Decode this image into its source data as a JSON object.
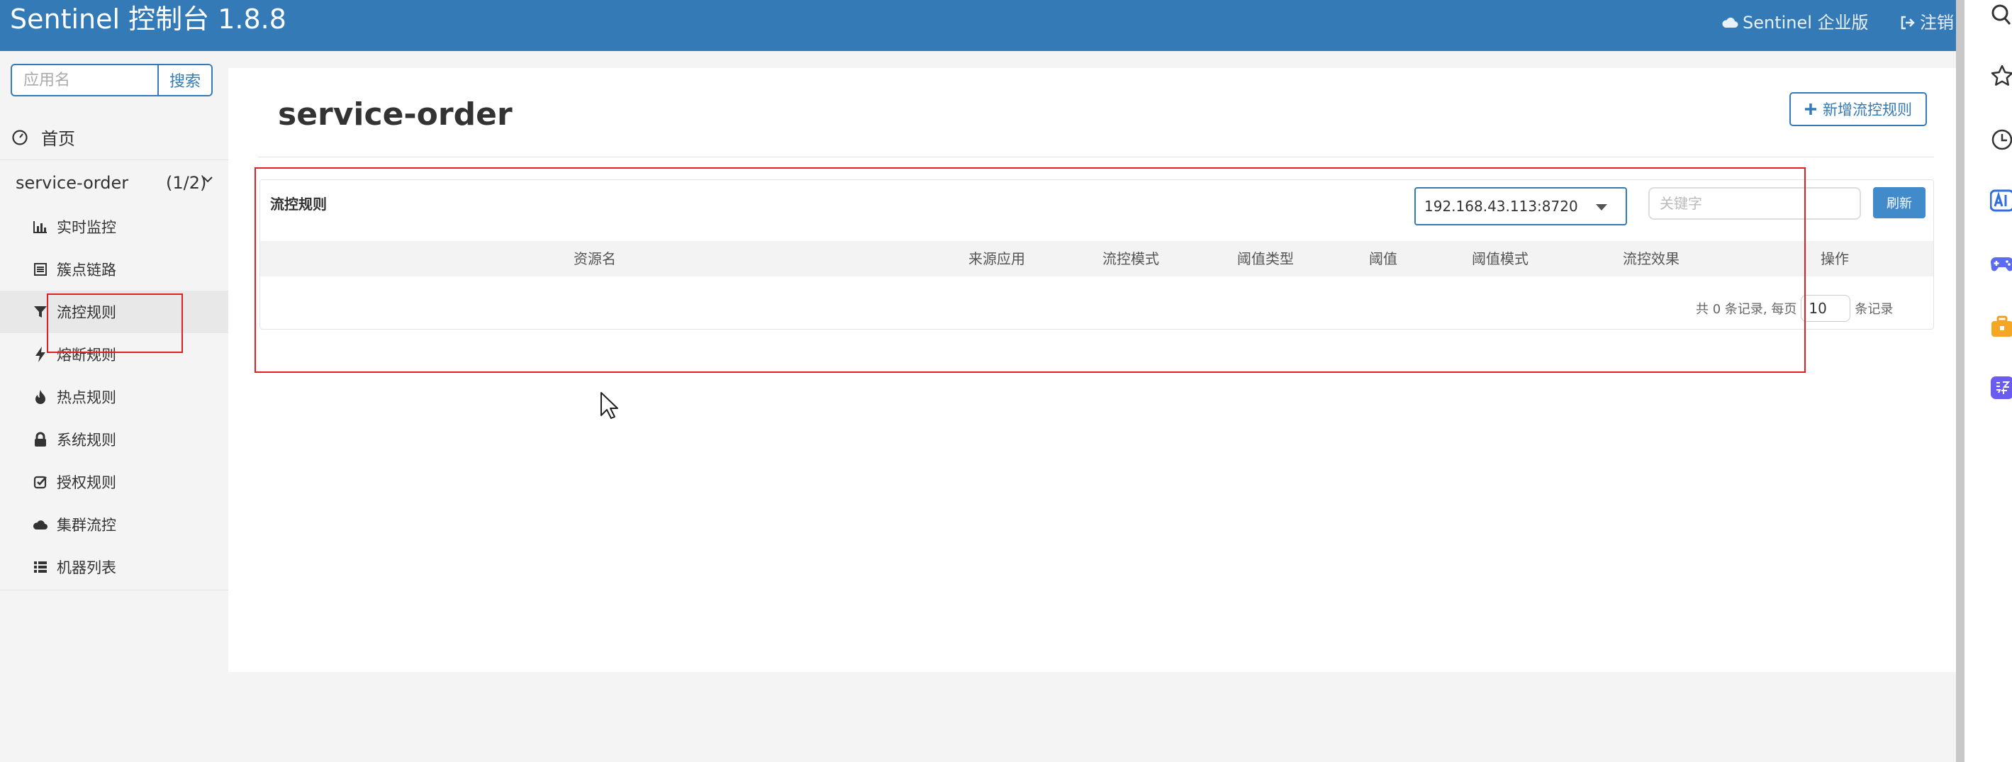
{
  "header": {
    "brand": "Sentinel 控制台 1.8.8",
    "enterprise_label": "Sentinel 企业版",
    "logout_label": "注销"
  },
  "sidebar": {
    "search_placeholder": "应用名",
    "search_button": "搜索",
    "home_label": "首页",
    "app_name": "service-order",
    "app_count": "(1/2)",
    "items": [
      {
        "label": "实时监控",
        "icon": "bar-chart-icon"
      },
      {
        "label": "簇点链路",
        "icon": "list-alt-icon"
      },
      {
        "label": "流控规则",
        "icon": "filter-icon",
        "active": true
      },
      {
        "label": "熔断规则",
        "icon": "flash-icon"
      },
      {
        "label": "热点规则",
        "icon": "fire-icon"
      },
      {
        "label": "系统规则",
        "icon": "lock-icon"
      },
      {
        "label": "授权规则",
        "icon": "check-icon"
      },
      {
        "label": "集群流控",
        "icon": "cloud-icon"
      },
      {
        "label": "机器列表",
        "icon": "list-icon"
      }
    ]
  },
  "main": {
    "page_title": "service-order",
    "add_button": "新增流控规则",
    "panel_title": "流控规则",
    "machine_select": "192.168.43.113:8720",
    "keyword_placeholder": "关键字",
    "refresh_button": "刷新",
    "columns": [
      "资源名",
      "来源应用",
      "流控模式",
      "阈值类型",
      "阈值",
      "阈值模式",
      "流控效果",
      "操作"
    ],
    "pager": {
      "summary": "共 0 条记录, 每页",
      "page_size": "10",
      "suffix": "条记录"
    }
  },
  "colors": {
    "header_bg": "#337ab7",
    "accent": "#337ab7",
    "refresh_bg": "#428bca",
    "annotation": "#e02020"
  }
}
